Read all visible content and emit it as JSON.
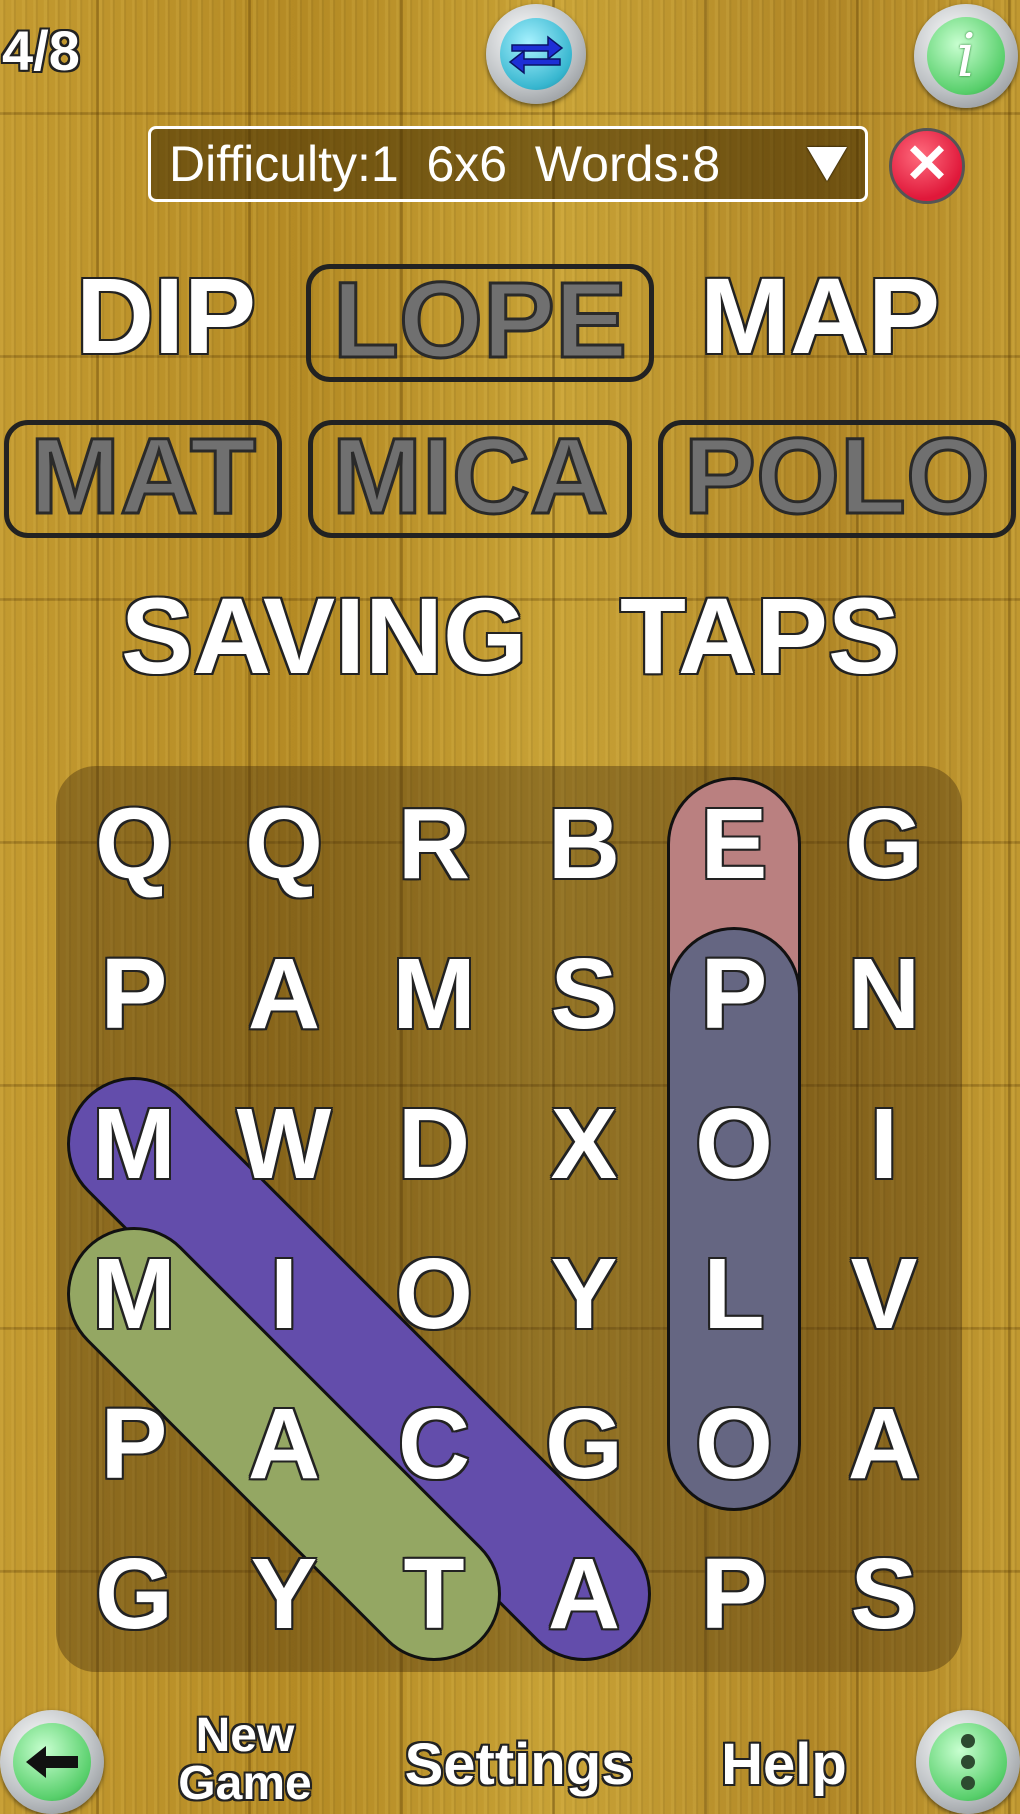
{
  "counter": "4/8",
  "settings_bar": {
    "difficulty_text": "Difficulty:1  6x6  Words:8"
  },
  "words": [
    {
      "text": "DIP",
      "found": false
    },
    {
      "text": "LOPE",
      "found": true
    },
    {
      "text": "MAP",
      "found": false
    },
    {
      "text": "MAT",
      "found": true
    },
    {
      "text": "MICA",
      "found": true
    },
    {
      "text": "POLO",
      "found": true
    },
    {
      "text": "SAVING",
      "found": false
    },
    {
      "text": "TAPS",
      "found": false
    }
  ],
  "grid": [
    [
      "Q",
      "Q",
      "R",
      "B",
      "E",
      "G"
    ],
    [
      "P",
      "A",
      "M",
      "S",
      "P",
      "N"
    ],
    [
      "M",
      "W",
      "D",
      "X",
      "O",
      "I"
    ],
    [
      "M",
      "I",
      "O",
      "Y",
      "L",
      "V"
    ],
    [
      "P",
      "A",
      "C",
      "G",
      "O",
      "A"
    ],
    [
      "G",
      "Y",
      "T",
      "A",
      "P",
      "S"
    ]
  ],
  "highlights": [
    {
      "word": "LOPE",
      "color": "#c98a8a"
    },
    {
      "word": "POLO",
      "color": "#6c6e8c"
    },
    {
      "word": "MICA",
      "color": "#6a52b8"
    },
    {
      "word": "MAT",
      "color": "#9fb46a"
    }
  ],
  "icons": {
    "swap": "swap-arrows-icon",
    "info": "info-icon",
    "close": "close-icon",
    "back": "back-arrow-icon",
    "menu": "more-vertical-icon"
  },
  "bottom_bar": {
    "new_game": "New Game",
    "settings": "Settings",
    "help": "Help"
  }
}
